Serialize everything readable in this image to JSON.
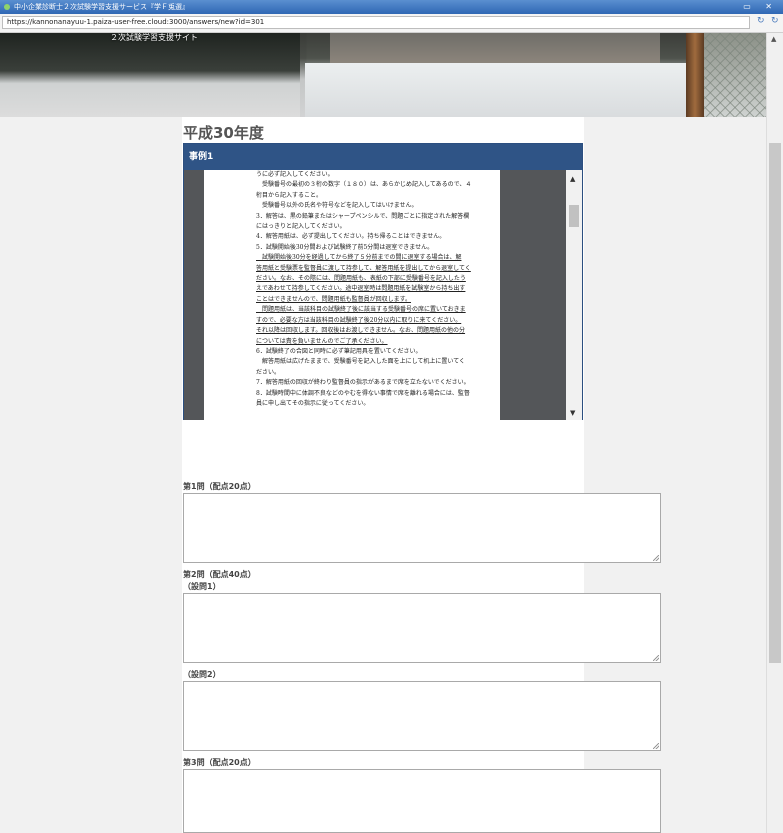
{
  "window": {
    "title": "中小企業診断士２次試験学習支援サービス『学Ｆ兎選』",
    "controls": "▭ ✕"
  },
  "browser": {
    "url": "https://kannonanayuu-1.paiza-user-free.cloud:3000/answers/new?id=301",
    "reload_icon": "↻",
    "back_icon": "↻"
  },
  "header": {
    "site_title": "２次試験学習支援サイト"
  },
  "main": {
    "year_title": "平成30年度",
    "case_title": "事例1",
    "pdf_lines": [
      {
        "text": "うに必ず記入してください。",
        "u": false
      },
      {
        "text": "　受験番号の最初の３桁の数字（１８０）は、あらかじめ記入してあるので、４",
        "u": false
      },
      {
        "text": "桁目から記入すること。",
        "u": false
      },
      {
        "text": "　受験番号以外の氏名や符号などを記入してはいけません。",
        "u": false
      },
      {
        "text": "3．解答は、黒の鉛筆またはシャープペンシルで、問題ごとに指定された解答欄",
        "u": false
      },
      {
        "text": "にはっきりと記入してください。",
        "u": false
      },
      {
        "text": "4．解答用紙は、必ず提出してください。持ち帰ることはできません。",
        "u": false
      },
      {
        "text": "5．試験開始後30分間および試験終了前5分間は退室できません。",
        "u": false
      },
      {
        "text": "　試験開始後30分を経過してから終了５分前までの間に退室する場合は、解",
        "u": true
      },
      {
        "text": "答用紙と受験票を監督員に渡して持参して、解答用紙を提出してから退室してく",
        "u": true
      },
      {
        "text": "ださい。なお、その際には、問題用紙も、表紙の下部に受験番号を記入したう",
        "u": true
      },
      {
        "text": "えであわせて持参してください。途中退室時は問題用紙を試験室から持ち出す",
        "u": true
      },
      {
        "text": "ことはできませんので、問題用紙も監督員が回収します。",
        "u": true
      },
      {
        "text": "　問題用紙は、当該科目の試験終了後に該当する受験番号の席に置いておきま",
        "u": true
      },
      {
        "text": "すので、必要な方は当該科目の試験終了後20分以内に取りに来てください。",
        "u": true
      },
      {
        "text": "それ以降は回収します。回収後はお渡しできません。なお、問題用紙の他の分",
        "u": true
      },
      {
        "text": "については責を負いませんのでご了承ください。",
        "u": true
      },
      {
        "text": "6．試験終了の合図と同時に必ず筆記用具を置いてください。",
        "u": false
      },
      {
        "text": "　解答用紙は広げたままで、受験番号を記入した面を上にして机上に置いてく",
        "u": false
      },
      {
        "text": "ださい。",
        "u": false
      },
      {
        "text": "7．解答用紙の回収が終わり監督員の指示があるまで席を立たないでください。",
        "u": false
      },
      {
        "text": "8．試験時間中に体調不良などのやむを得ない事情で席を離れる場合には、監督",
        "u": false
      },
      {
        "text": "員に申し出てその指示に従ってください。",
        "u": false
      }
    ],
    "questions": [
      {
        "label": "第1問（配点20点）",
        "sub": ""
      },
      {
        "label": "第2問（配点40点）",
        "sub": "（設問1）"
      },
      {
        "label": "",
        "sub": "（設問2）"
      },
      {
        "label": "第3問（配点20点）",
        "sub": ""
      }
    ]
  },
  "icons": {
    "scroll_up": "▲",
    "scroll_down": "▼"
  }
}
